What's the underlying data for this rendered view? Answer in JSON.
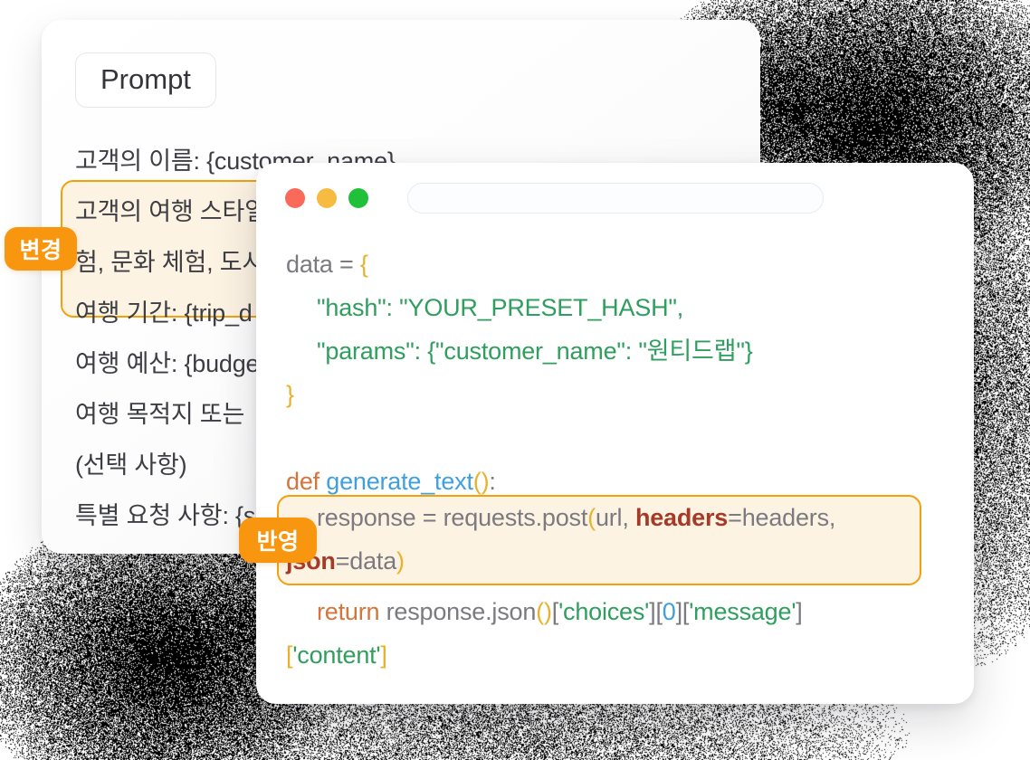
{
  "background": {
    "color": "#ffffff",
    "shadow_style": "dithered-noise-blob"
  },
  "colors": {
    "accent_orange": "#f9960f",
    "highlight_fill": "#fdf3e3",
    "highlight_border": "#f2a10c",
    "code_string_green": "#2f9e5e",
    "code_brace_yellow": "#e8b22e",
    "code_keyword_orange": "#d2763c",
    "code_function_blue": "#3fa0dd",
    "code_param_red": "#a63a28",
    "code_plain_grey": "#7a7a80",
    "dot_red": "#fa6a5a",
    "dot_yellow": "#f8bb41",
    "dot_green": "#21c03a"
  },
  "prompt_card": {
    "pill_label": "Prompt",
    "lines": [
      "고객의 이름: {customer_name}",
      "여행 예산: {budget}",
      "여행 목적지 또는",
      "(선택 사항)",
      "특별 요청 사항: {s"
    ],
    "highlight_lines": [
      "고객의 여행 스타일",
      "험, 문화 체험, 도시",
      "여행 기간: {trip_d"
    ]
  },
  "badges": {
    "change": "변경",
    "apply": "반영"
  },
  "code_card": {
    "titlebar": {
      "dots": [
        "red",
        "yellow",
        "green"
      ],
      "url_value": "",
      "url_placeholder": ""
    },
    "lines": {
      "l1_plain": "data = ",
      "l1_brace": "{",
      "l2_str": "\"hash\": \"YOUR_PRESET_HASH\",",
      "l3_str": "\"params\": {\"customer_name\": \"원티드랩\"}",
      "l4_brace": "}",
      "l6_kw": "def ",
      "l6_fn": "generate_text",
      "l6_paren": "()",
      "l6_colon": ":",
      "l9_kw": "return ",
      "l9_plain": "response.json",
      "l9_paren": "()",
      "l9_b1_open": "[",
      "l9_s1": "'choices'",
      "l9_b1_close": "]",
      "l9_b2_open": "[",
      "l9_num": "0",
      "l9_b2_close": "]",
      "l9_b3_open": "[",
      "l9_s2": "'message'",
      "l9_b3_close": "]",
      "l10_b_open": "[",
      "l10_s": "'content'",
      "l10_b_close": "]"
    },
    "highlight_lines": {
      "h1_a": "response = requests.post",
      "h1_paren": "(",
      "h1_b": "url, ",
      "h1_param": "headers",
      "h1_c": "=headers,",
      "h2_param": "json",
      "h2_b": "=data",
      "h2_paren": ")"
    }
  }
}
